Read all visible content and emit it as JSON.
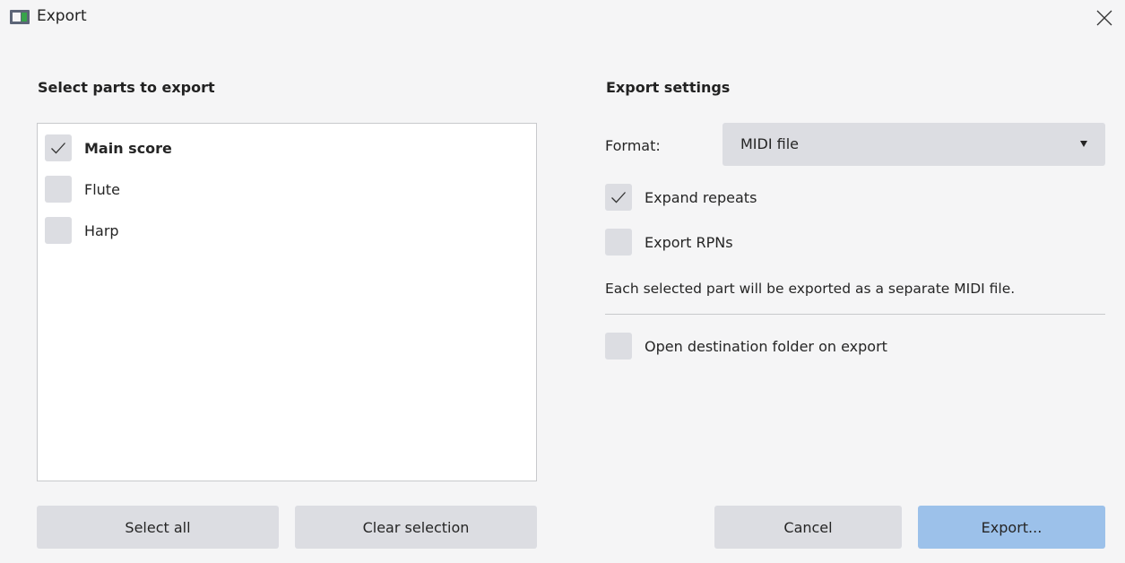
{
  "window": {
    "title": "Export",
    "icon": "app-icon",
    "close_icon": "close-icon"
  },
  "parts": {
    "heading": "Select parts to export",
    "items": [
      {
        "label": "Main score",
        "checked": true,
        "bold": true
      },
      {
        "label": "Flute",
        "checked": false,
        "bold": false
      },
      {
        "label": "Harp",
        "checked": false,
        "bold": false
      }
    ],
    "select_all_label": "Select all",
    "clear_selection_label": "Clear selection"
  },
  "settings": {
    "heading": "Export settings",
    "format_label": "Format:",
    "format_value": "MIDI file",
    "expand_repeats_label": "Expand repeats",
    "expand_repeats_checked": true,
    "export_rpns_label": "Export RPNs",
    "export_rpns_checked": false,
    "note": "Each selected part will be exported as a separate MIDI file.",
    "open_folder_label": "Open destination folder on export",
    "open_folder_checked": false
  },
  "actions": {
    "cancel_label": "Cancel",
    "export_label": "Export..."
  },
  "colors": {
    "background": "#f5f5f6",
    "control": "#dcdde2",
    "primary_button": "#9cc1ea",
    "list_background": "#ffffff"
  }
}
